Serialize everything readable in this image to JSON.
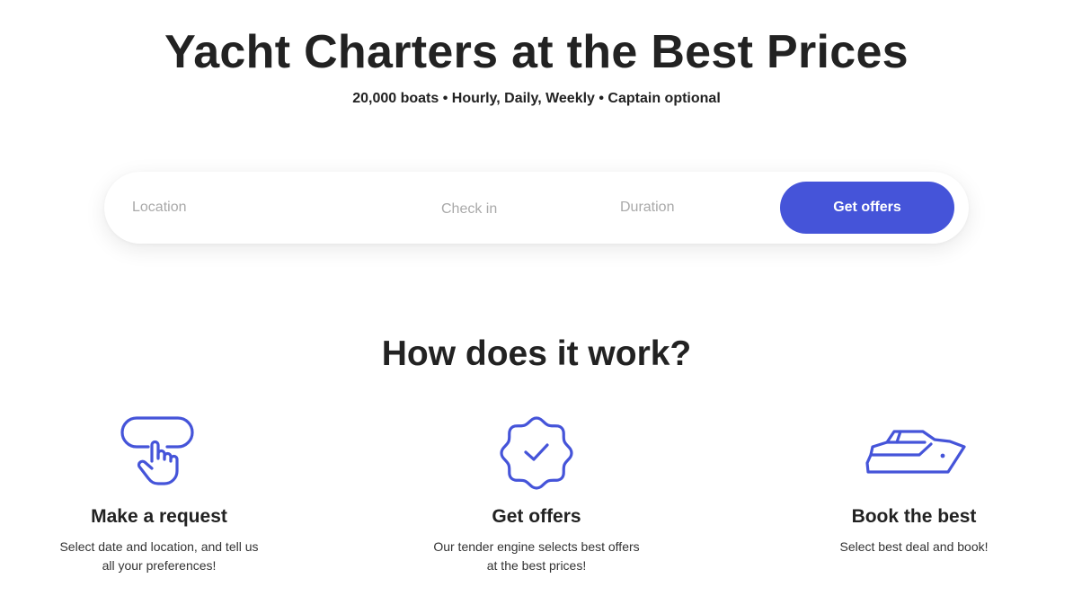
{
  "hero": {
    "title": "Yacht Charters at the Best Prices",
    "subtitle": "20,000 boats • Hourly, Daily, Weekly • Captain optional"
  },
  "search": {
    "location_placeholder": "Location",
    "checkin_placeholder": "Check in",
    "duration_placeholder": "Duration",
    "button_label": "Get offers"
  },
  "how_it_works": {
    "title": "How does it work?",
    "steps": [
      {
        "icon": "tap-pointer-icon",
        "title": "Make a request",
        "text": "Select date and location, and tell us all your preferences!"
      },
      {
        "icon": "verified-badge-icon",
        "title": "Get offers",
        "text": "Our tender engine selects best offers at the best prices!"
      },
      {
        "icon": "yacht-icon",
        "title": "Book the best",
        "text": "Select best deal and book!"
      }
    ]
  },
  "colors": {
    "accent": "#4554d9",
    "heading": "#222222",
    "placeholder": "#a9a9a9"
  }
}
